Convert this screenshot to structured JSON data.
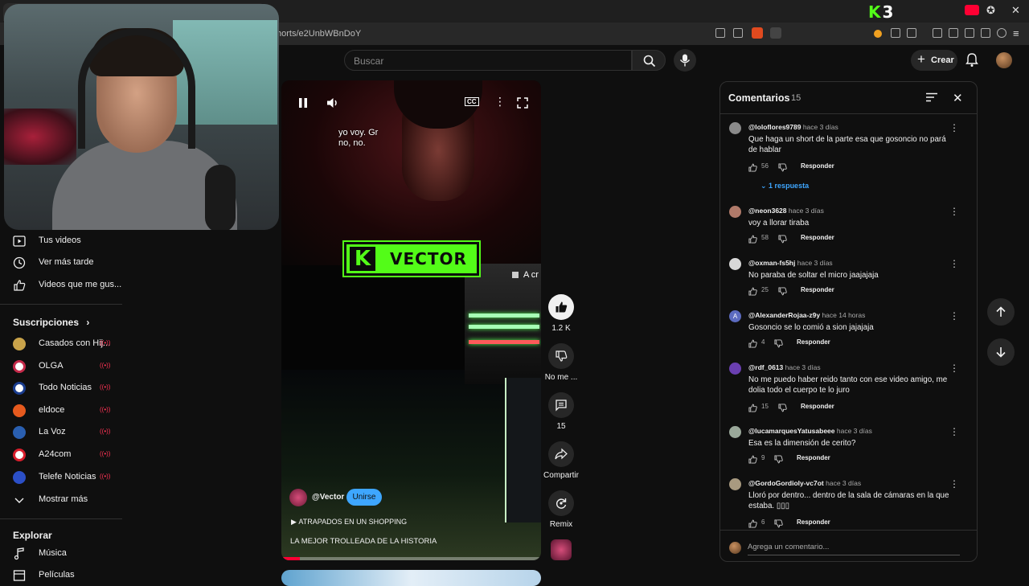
{
  "browser": {
    "url": "horts/e2UnbWBnDoY",
    "k3_logo": "K3"
  },
  "masthead": {
    "search_placeholder": "Buscar",
    "create_label": "Crear"
  },
  "sidebar": {
    "you_items": [
      {
        "label": "Tus videos",
        "icon": "play-square-icon"
      },
      {
        "label": "Ver más tarde",
        "icon": "clock-icon"
      },
      {
        "label": "Videos que me gus...",
        "icon": "thumb-up-icon"
      }
    ],
    "subscriptions_title": "Suscripciones",
    "subscriptions": [
      {
        "label": "Casados con Hij...",
        "color": "#c9a34a"
      },
      {
        "label": "OLGA",
        "color": "#ffffff"
      },
      {
        "label": "Todo Noticias",
        "color": "#1a3d8f"
      },
      {
        "label": "eldoce",
        "color": "#e65a1e"
      },
      {
        "label": "La Voz",
        "color": "#2a5fb0"
      },
      {
        "label": "A24com",
        "color": "#d81e2c"
      },
      {
        "label": "Telefe Noticias",
        "color": "#2b4fc7"
      }
    ],
    "show_more": "Mostrar más",
    "explore_title": "Explorar",
    "explore_items": [
      {
        "label": "Música",
        "icon": "music-note-icon"
      },
      {
        "label": "Películas",
        "icon": "film-icon"
      }
    ]
  },
  "short": {
    "subtitle": [
      "yo voy. Gr",
      "no, no."
    ],
    "badge_text": "VECTOR",
    "overlay_text": "A cr",
    "channel": "@Vector",
    "join_label": "Unirse",
    "playlist": "ATRAPADOS EN UN SHOPPING",
    "title": "LA MEJOR TROLLEADA DE LA HISTORIA",
    "progress": 0.07
  },
  "actions": {
    "likes": "1.2 K",
    "dislike_label": "No me ...",
    "comments": "15",
    "share_label": "Compartir",
    "remix_label": "Remix"
  },
  "comments_panel": {
    "title": "Comentarios",
    "count": "15",
    "reply_label": "Responder",
    "add_placeholder": "Agrega un comentario...",
    "items": [
      {
        "author": "@loloflores9789",
        "time": "hace 3 días",
        "text": "Que haga un short de la parte esa que gosoncio no pará de hablar",
        "likes": "56",
        "avatar_color": "#8a8a8a",
        "replies": "1 respuesta"
      },
      {
        "author": "@neon3628",
        "time": "hace 3 días",
        "text": "voy a llorar tiraba",
        "likes": "58",
        "avatar_color": "#b07a6a"
      },
      {
        "author": "@oxman-fs5hj",
        "time": "hace 3 días",
        "text": "No paraba de soltar el micro jaajajaja",
        "likes": "25",
        "avatar_color": "#d8d8d8"
      },
      {
        "author": "@AlexanderRojaa-z9y",
        "time": "hace 14 horas",
        "text": "Gosoncio se lo comió a sion jajajaja",
        "likes": "4",
        "avatar_color": "#5c6bc0",
        "initial": "A"
      },
      {
        "author": "@rdf_0613",
        "time": "hace 3 días",
        "text": "No me puedo haber reido tanto con ese video amigo, me dolia todo el cuerpo te lo juro",
        "likes": "15",
        "avatar_color": "#6a3fb0"
      },
      {
        "author": "@lucamarquesYatusabeee",
        "time": "hace 3 días",
        "text": "Esa es la dimensión de cerito?",
        "likes": "9",
        "avatar_color": "#9aa89a"
      },
      {
        "author": "@GordoGordioly-vc7ot",
        "time": "hace 3 días",
        "text": "Lloró por dentro... dentro de la sala de cámaras en la que estaba. ▯▯▯",
        "likes": "6",
        "avatar_color": "#a89a80"
      }
    ]
  }
}
